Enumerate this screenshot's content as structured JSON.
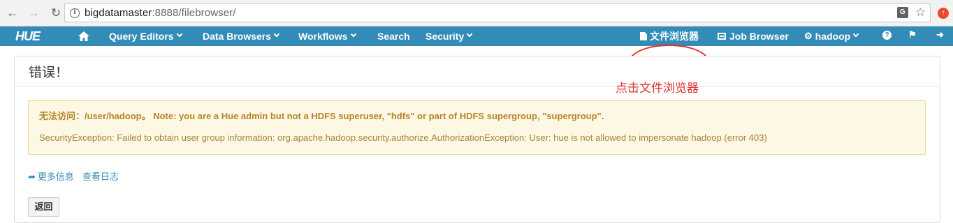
{
  "browser": {
    "url_host": "bigdatamaster",
    "url_rest": ":8888/filebrowser/"
  },
  "navbar": {
    "logo": "HUE",
    "items": [
      {
        "label": "Query Editors"
      },
      {
        "label": "Data Browsers"
      },
      {
        "label": "Workflows"
      },
      {
        "label": "Search"
      },
      {
        "label": "Security"
      }
    ],
    "right": [
      {
        "label": "文件浏览器"
      },
      {
        "label": "Job Browser"
      },
      {
        "label": "hadoop"
      }
    ],
    "highlight_color": "#e0322b",
    "bar_color": "#338bb8"
  },
  "page": {
    "heading": "错误！",
    "annotation": "点击文件浏览器",
    "alert_title": "无法访问：/user/hadoop。 Note: you are a Hue admin but not a HDFS superuser, \"hdfs\" or part of HDFS supergroup, \"supergroup\".",
    "alert_detail": "SecurityException: Failed to obtain user group information: org.apache.hadoop.security.authorize.AuthorizationException: User: hue is not allowed to impersonate hadoop (error 403)",
    "link_more": "更多信息",
    "link_logs": "查看日志",
    "back_button": "返回"
  }
}
